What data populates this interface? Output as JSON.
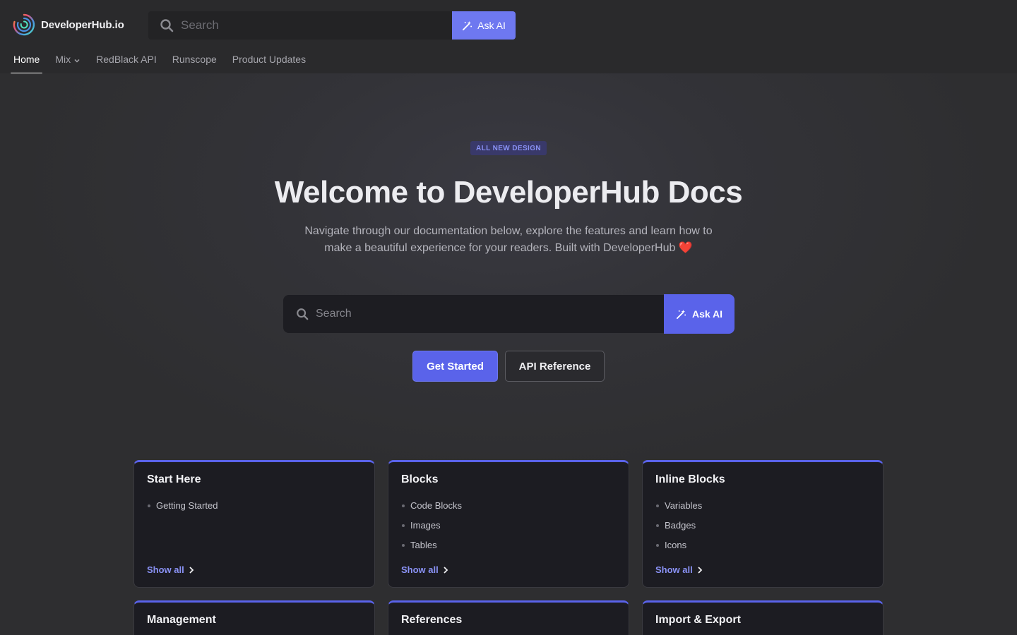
{
  "brand": {
    "name": "DeveloperHub.io"
  },
  "topbar": {
    "search_placeholder": "Search",
    "ask_ai_label": "Ask AI"
  },
  "nav": {
    "items": [
      {
        "label": "Home",
        "active": true
      },
      {
        "label": "Mix",
        "has_dropdown": true
      },
      {
        "label": "RedBlack API"
      },
      {
        "label": "Runscope"
      },
      {
        "label": "Product Updates"
      }
    ]
  },
  "hero": {
    "badge": "ALL NEW DESIGN",
    "title": "Welcome to DeveloperHub Docs",
    "subtitle": "Navigate through our documentation below, explore the features and learn how to make a beautiful experience for your readers. Built with DeveloperHub ❤️",
    "search_placeholder": "Search",
    "ask_ai_label": "Ask AI",
    "primary_button": "Get Started",
    "secondary_button": "API Reference"
  },
  "cards": [
    {
      "title": "Start Here",
      "items": [
        "Getting Started"
      ],
      "show_all": "Show all"
    },
    {
      "title": "Blocks",
      "items": [
        "Code Blocks",
        "Images",
        "Tables"
      ],
      "show_all": "Show all"
    },
    {
      "title": "Inline Blocks",
      "items": [
        "Variables",
        "Badges",
        "Icons"
      ],
      "show_all": "Show all"
    },
    {
      "title": "Management"
    },
    {
      "title": "References"
    },
    {
      "title": "Import & Export"
    }
  ],
  "colors": {
    "accent": "#5a63ea",
    "accent_light": "#6e78f0",
    "link": "#8a92f5",
    "background": "#2c2c2e",
    "card_bg": "#1c1c22"
  }
}
